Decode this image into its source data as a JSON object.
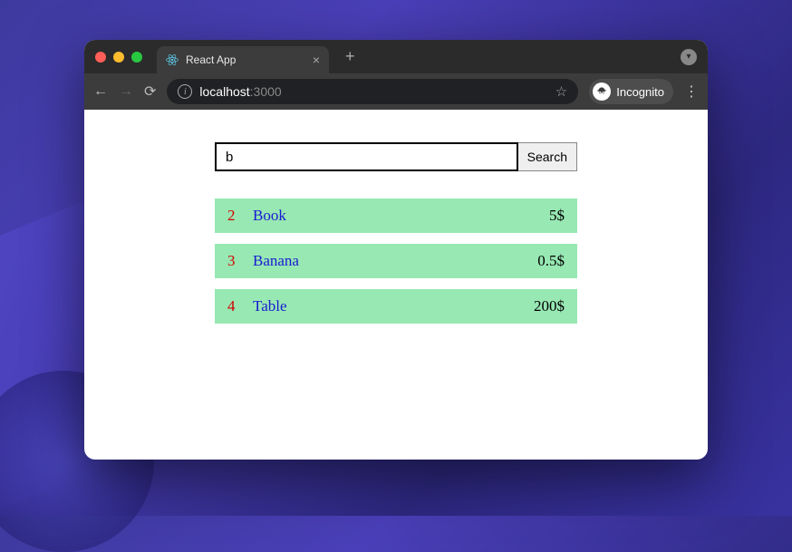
{
  "browser": {
    "tab_title": "React App",
    "url_host": "localhost",
    "url_port": ":3000",
    "incognito_label": "Incognito",
    "new_tab_symbol": "+",
    "close_tab_symbol": "×",
    "star_symbol": "☆",
    "menu_symbol": "⋮",
    "info_symbol": "i",
    "back_symbol": "←",
    "forward_symbol": "→",
    "reload_symbol": "⟳",
    "down_symbol": "▾"
  },
  "search": {
    "value": "b",
    "button_label": "Search"
  },
  "results": [
    {
      "id": "2",
      "name": "Book",
      "price": "5$"
    },
    {
      "id": "3",
      "name": "Banana",
      "price": "0.5$"
    },
    {
      "id": "4",
      "name": "Table",
      "price": "200$"
    }
  ]
}
